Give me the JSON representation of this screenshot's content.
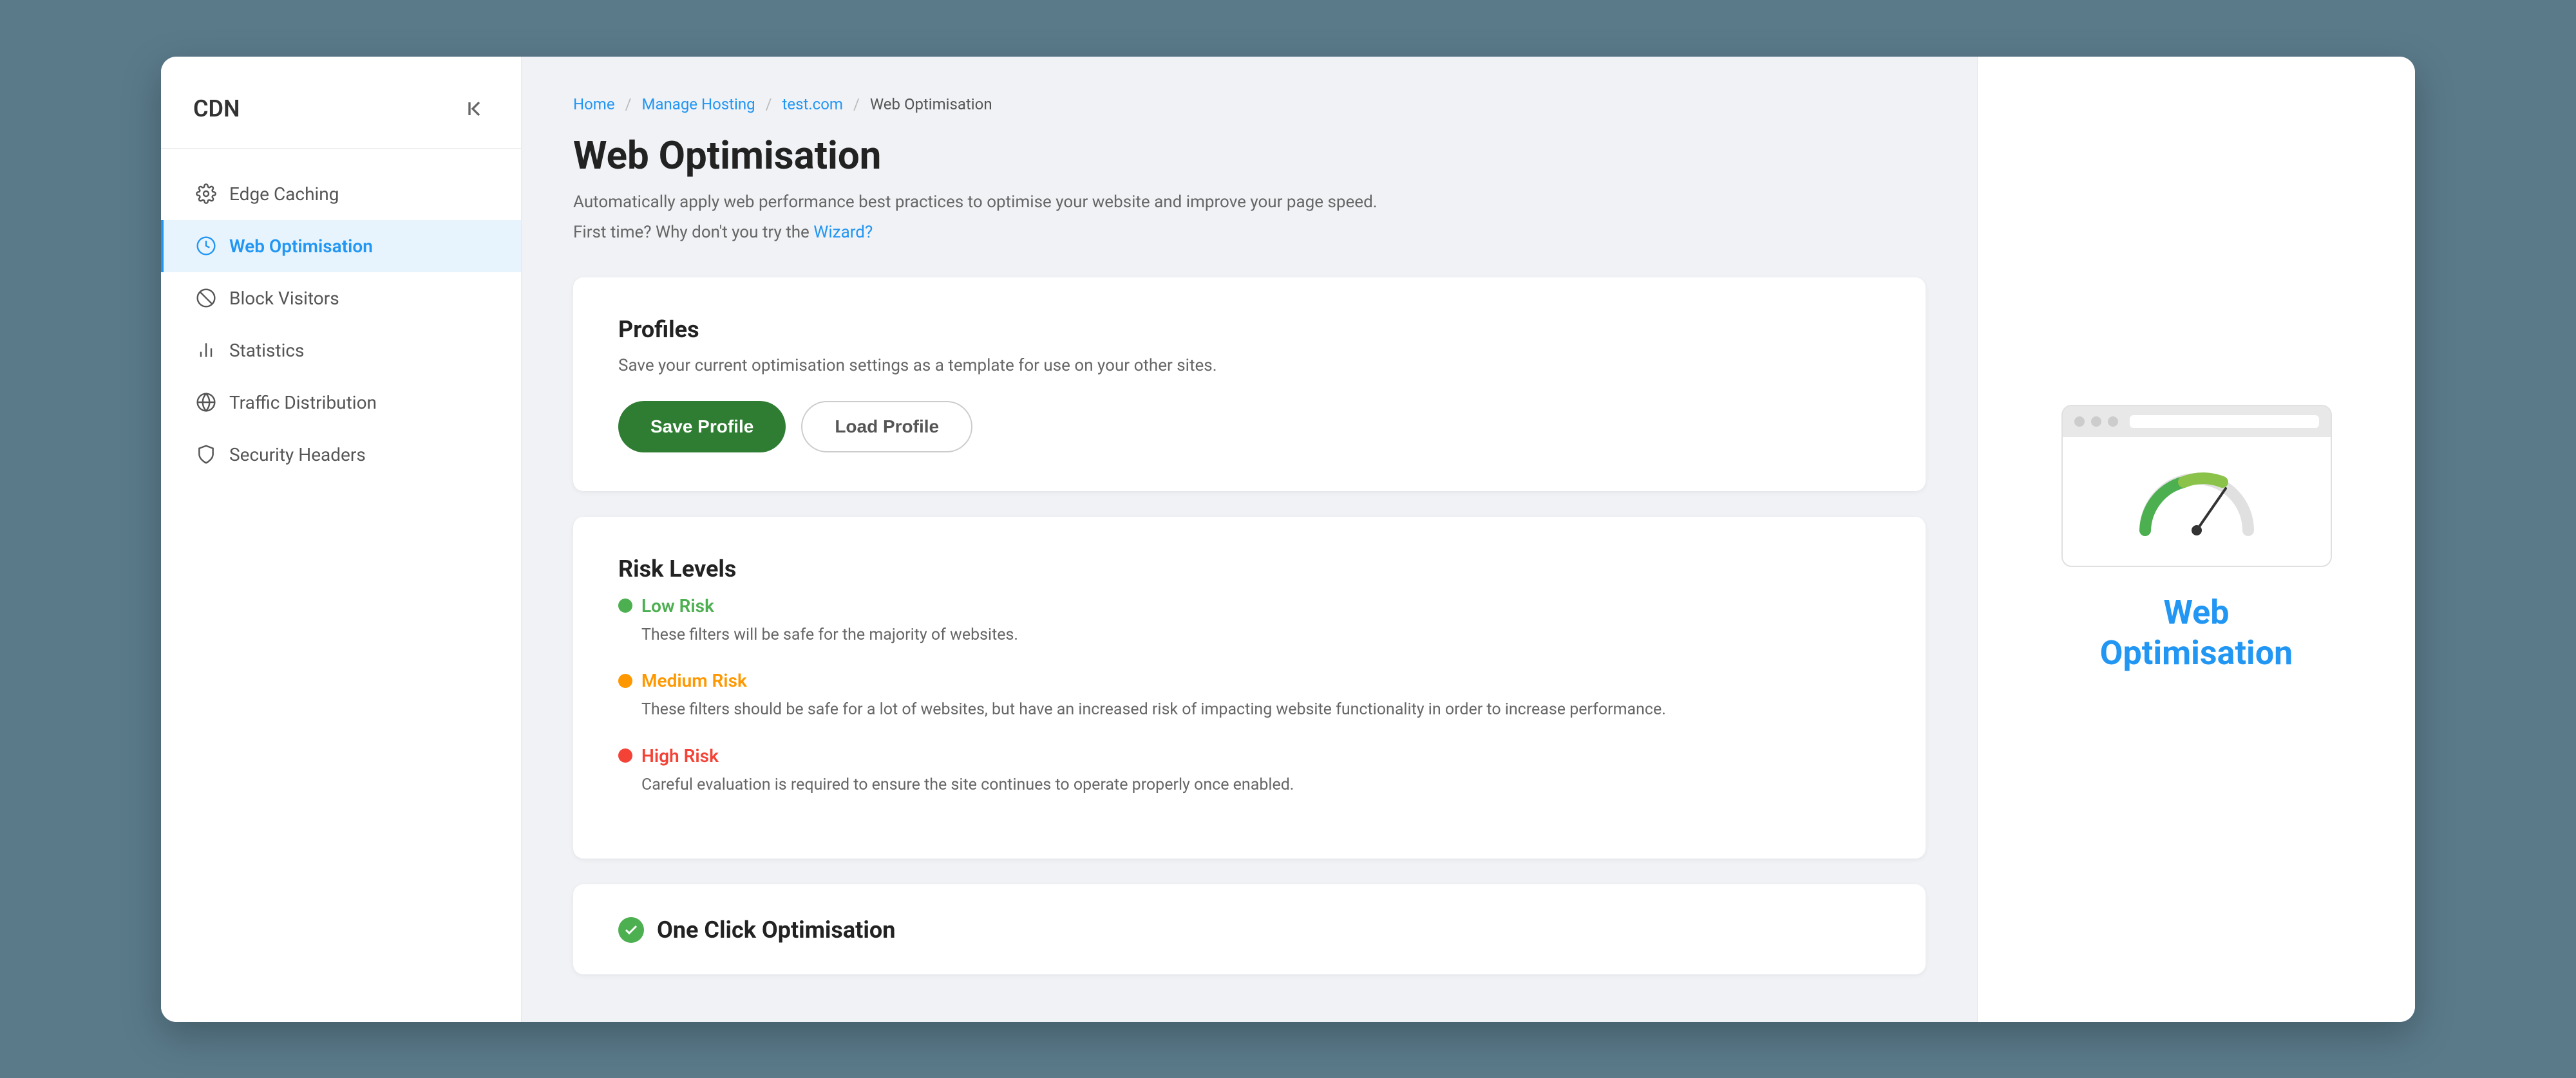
{
  "sidebar": {
    "title": "CDN",
    "items": [
      {
        "id": "edge-caching",
        "label": "Edge Caching",
        "icon": "gear-icon",
        "active": false
      },
      {
        "id": "web-optimisation",
        "label": "Web Optimisation",
        "icon": "clock-icon",
        "active": true
      },
      {
        "id": "block-visitors",
        "label": "Block Visitors",
        "icon": "block-icon",
        "active": false
      },
      {
        "id": "statistics",
        "label": "Statistics",
        "icon": "chart-icon",
        "active": false
      },
      {
        "id": "traffic-distribution",
        "label": "Traffic Distribution",
        "icon": "globe-icon",
        "active": false
      },
      {
        "id": "security-headers",
        "label": "Security Headers",
        "icon": "shield-icon",
        "active": false
      }
    ]
  },
  "breadcrumb": {
    "items": [
      {
        "label": "Home",
        "href": "#"
      },
      {
        "label": "Manage Hosting",
        "href": "#"
      },
      {
        "label": "test.com",
        "href": "#"
      },
      {
        "label": "Web Optimisation",
        "href": null
      }
    ]
  },
  "page": {
    "title": "Web Optimisation",
    "description_line1": "Automatically apply web performance best practices to optimise your website and improve your page speed.",
    "description_line2": "First time? Why don't you try the",
    "wizard_link": "Wizard?"
  },
  "profiles_card": {
    "title": "Profiles",
    "description": "Save your current optimisation settings as a template for use on your other sites.",
    "save_button": "Save Profile",
    "load_button": "Load Profile"
  },
  "risk_levels_card": {
    "title": "Risk Levels",
    "items": [
      {
        "level": "low",
        "label": "Low Risk",
        "description": "These filters will be safe for the majority of websites."
      },
      {
        "level": "medium",
        "label": "Medium Risk",
        "description": "These filters should be safe for a lot of websites, but have an increased risk of impacting website functionality in order to increase performance."
      },
      {
        "level": "high",
        "label": "High Risk",
        "description": "Careful evaluation is required to ensure the site continues to operate properly once enabled."
      }
    ]
  },
  "one_click_card": {
    "title": "One Click Optimisation"
  },
  "right_panel": {
    "title_line1": "Web",
    "title_line2": "Optimisation"
  },
  "colors": {
    "accent_blue": "#2196F3",
    "green": "#4caf50",
    "orange": "#ff9800",
    "red": "#f44336",
    "sidebar_active_bg": "#e8f4fd",
    "sidebar_active_border": "#2196F3"
  }
}
